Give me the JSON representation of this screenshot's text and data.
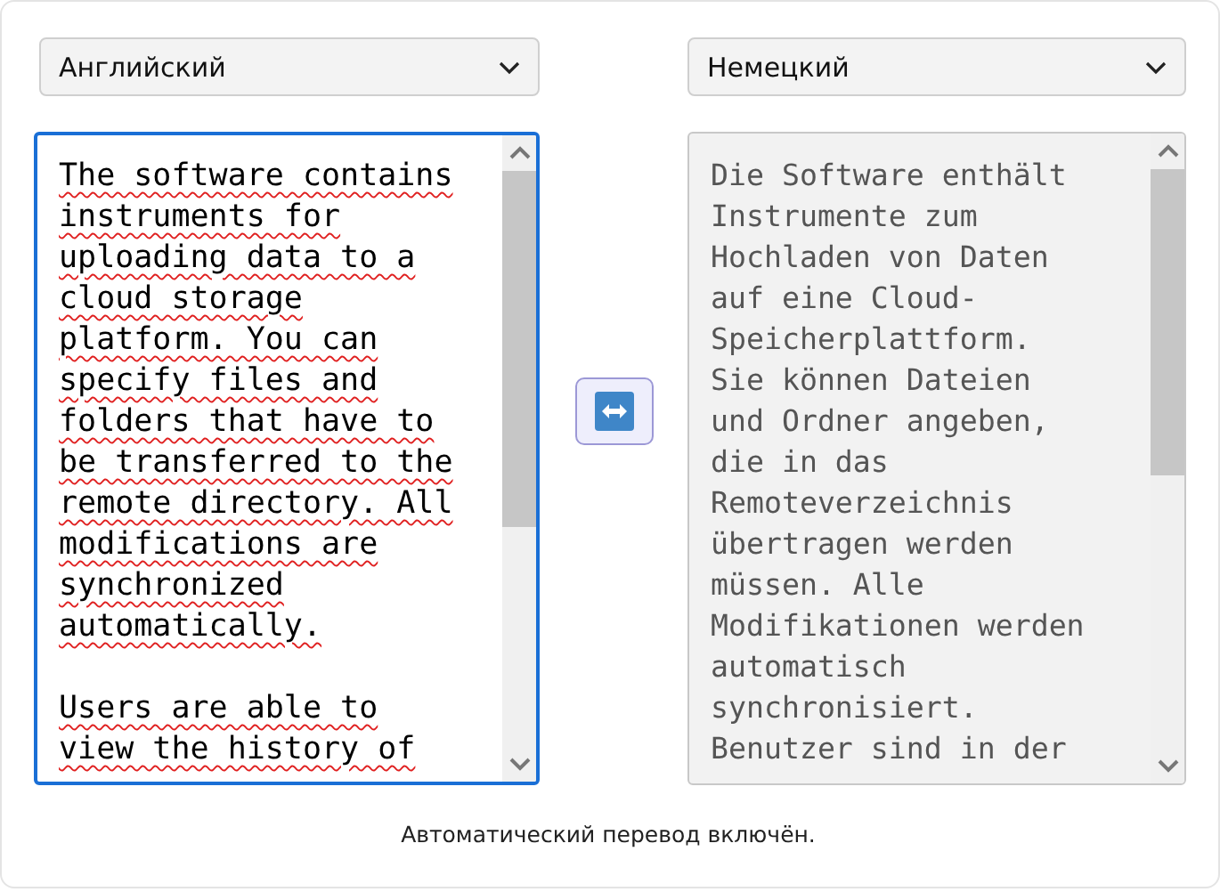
{
  "source": {
    "language": "Английский",
    "focused": true,
    "readonly": false,
    "paragraphs": [
      [
        "The software contains",
        "instruments for",
        "uploading data to a",
        "cloud storage",
        "platform. You can",
        "specify files and",
        "folders that have to",
        "be transferred to the",
        "remote directory. All",
        "modifications are",
        "synchronized",
        "automatically."
      ],
      [
        "Users are able to",
        "view the history of"
      ]
    ]
  },
  "target": {
    "language": "Немецкий",
    "focused": false,
    "readonly": true,
    "paragraphs": [
      [
        "Die Software enthält",
        "Instrumente zum",
        "Hochladen von Daten",
        "auf eine Cloud-",
        "Speicherplattform.",
        "Sie können Dateien",
        "und Ordner angeben,",
        "die in das",
        "Remoteverzeichnis",
        "übertragen werden",
        "müssen. Alle",
        "Modifikationen werden",
        "automatisch",
        "synchronisiert.",
        "Benutzer sind in der"
      ]
    ]
  },
  "status": "Автоматический перевод включён."
}
